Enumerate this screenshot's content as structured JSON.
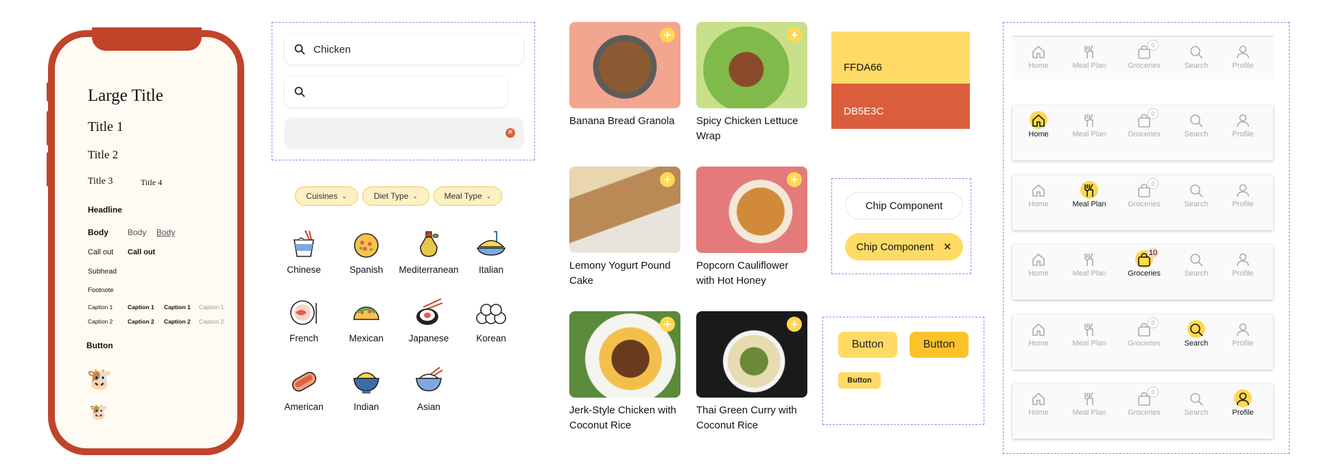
{
  "typography": {
    "large_title": "Large Title",
    "title1": "Title 1",
    "title2": "Title 2",
    "title3": "Title 3",
    "title4": "Title 4",
    "headline": "Headline",
    "body": [
      "Body",
      "Body",
      "Body"
    ],
    "callout": [
      "Call out",
      "Call out"
    ],
    "subhead": "Subhead",
    "footnote": "Footnote",
    "caption1": [
      "Caption 1",
      "Caption 1",
      "Caption 1",
      "Caption 1"
    ],
    "caption2": [
      "Caption 2",
      "Caption 2",
      "Caption 2",
      "Caption 2"
    ],
    "button": "Button"
  },
  "search": {
    "query": "Chicken",
    "placeholder": ""
  },
  "filters": [
    "Cuisines",
    "Diet Type",
    "Meal Type"
  ],
  "cuisines": [
    "Chinese",
    "Spanish",
    "Mediterranean",
    "Italian",
    "French",
    "Mexican",
    "Japanese",
    "Korean",
    "American",
    "Indian",
    "Asian"
  ],
  "recipes": [
    "Banana Bread Granola",
    "Spicy Chicken Lettuce Wrap",
    "Lemony Yogurt Pound Cake",
    "Popcorn Cauliflower with Hot Honey",
    "Jerk-Style Chicken with Coconut Rice",
    "Thai Green Curry with Coconut Rice"
  ],
  "colors": {
    "yellow": "FFDA66",
    "red": "DB5E3C"
  },
  "chips": {
    "default": "Chip Component",
    "selected": "Chip Component"
  },
  "buttons": [
    "Button",
    "Button",
    "Button"
  ],
  "tabbar": {
    "tabs": [
      "Home",
      "Meal Plan",
      "Groceries",
      "Search",
      "Profile"
    ],
    "badge_zero": "0",
    "badge_count": "10"
  }
}
